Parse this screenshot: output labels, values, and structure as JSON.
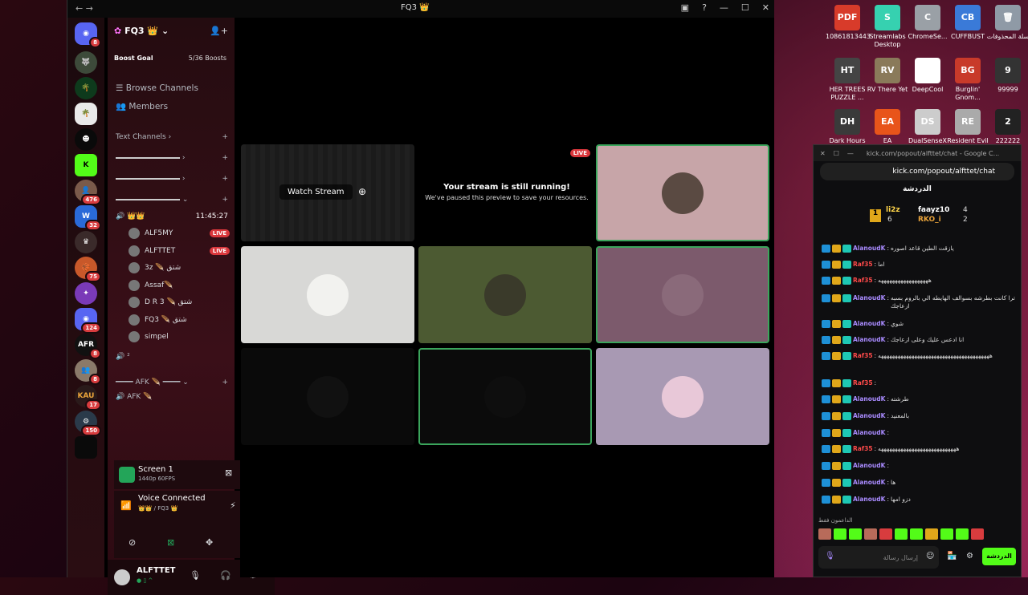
{
  "desktop": {
    "icons": [
      {
        "label": "10861813443",
        "color": "#d83b2a",
        "glyph": "PDF"
      },
      {
        "label": "Streamlabs Desktop",
        "color": "#36d1b0",
        "glyph": "S"
      },
      {
        "label": "ChromeSe...",
        "color": "#9aa0a6",
        "glyph": "C"
      },
      {
        "label": "CUFFBUST",
        "color": "#3a7ad8",
        "glyph": "CB"
      },
      {
        "label": "سلة المحذوفات",
        "color": "#8f9aa6",
        "glyph": "🗑"
      },
      {
        "label": "HER TREES PUZZLE ...",
        "color": "#444",
        "glyph": "HT"
      },
      {
        "label": "RV There Yet",
        "color": "#8a7a5a",
        "glyph": "RV"
      },
      {
        "label": "DeepCool",
        "color": "#ffffff",
        "glyph": "DC"
      },
      {
        "label": "Burglin' Gnom...",
        "color": "#c83a2a",
        "glyph": "BG"
      },
      {
        "label": "99999",
        "color": "#333",
        "glyph": "9"
      },
      {
        "label": "Dark Hours",
        "color": "#3a3a3a",
        "glyph": "DH"
      },
      {
        "label": "EA",
        "color": "#e8541a",
        "glyph": "EA"
      },
      {
        "label": "DualSenseX",
        "color": "#cccccc",
        "glyph": "DS"
      },
      {
        "label": "Resident Evil",
        "color": "#aaaaaa",
        "glyph": "RE"
      },
      {
        "label": "222222",
        "color": "#222",
        "glyph": "2"
      }
    ]
  },
  "discord": {
    "window_title": "FQ3 👑",
    "server_name": "FQ3 👑",
    "boost_goal": "Boost Goal",
    "boost_count": "5/36 Boosts",
    "browse_channels": "Browse Channels",
    "members": "Members",
    "text_channels": "Text Channels",
    "voice_channel_time": "11:45:27",
    "server_badges": [
      "8",
      "476",
      "32",
      "75",
      "124",
      "8",
      "8",
      "17",
      "150"
    ],
    "voice_users": [
      {
        "name": "ALF5MY",
        "live": "LIVE"
      },
      {
        "name": "ALFTTET",
        "live": "LIVE"
      },
      {
        "name": "3z 🪶 شتق",
        "live": ""
      },
      {
        "name": "Assaf🪶",
        "live": ""
      },
      {
        "name": "D R 3 🪶 شتق",
        "live": ""
      },
      {
        "name": "FQ3 🪶 شتق",
        "live": ""
      },
      {
        "name": "simpel",
        "live": ""
      }
    ],
    "voice_channel_2": "²",
    "afk_category": "AFK",
    "afk_channel": "AFK 🪶",
    "screen_title": "Screen 1",
    "screen_quality": "1440p 60FPS",
    "voice_connected": "Voice Connected",
    "voice_path": "👑👑 / FQ3 👑",
    "username": "ALFTTET",
    "user_status": "● ▯ ^"
  },
  "stage": {
    "watch_stream": "Watch Stream",
    "paused_title": "Your stream is still running!",
    "paused_sub": "We've paused this preview to save your resources.",
    "live_badge": "LIVE"
  },
  "kick_chat": {
    "tab_title": "kick.com/popout/alfttet/chat - Google C...",
    "url": "kick.com/popout/alfttet/chat",
    "header": "الدردشة",
    "leaders": [
      {
        "rank": "1",
        "name": "li2z",
        "count": "6"
      },
      {
        "name": "faayz10",
        "count": "4"
      },
      {
        "name": "RKO_i",
        "count": "2"
      }
    ],
    "messages": [
      {
        "user": "AlanoudK",
        "cls": "u-a",
        "text": "يازقت الطين قاعد اصوره"
      },
      {
        "user": "Raf35",
        "cls": "u-r",
        "text": "اما"
      },
      {
        "user": "Raf35",
        "cls": "u-r",
        "text": "ههههههههههههههههههه"
      },
      {
        "user": "AlanoudK",
        "cls": "u-a",
        "text": "ترا كانت بطرشه بسوالف الهايطه الي بالروم بسبه ازعاجك"
      },
      {
        "user": "AlanoudK",
        "cls": "u-a",
        "text": "شوي"
      },
      {
        "user": "AlanoudK",
        "cls": "u-a",
        "text": "انا ادعس عليك وعلى ازعاجك"
      },
      {
        "user": "Raf35",
        "cls": "u-r",
        "text": "ههههههههههههههههههههههههههههههههههههههههه"
      },
      {
        "user": "Raf35",
        "cls": "u-r",
        "text": ""
      },
      {
        "user": "AlanoudK",
        "cls": "u-a",
        "text": "طرشته"
      },
      {
        "user": "AlanoudK",
        "cls": "u-a",
        "text": "بالمعنيد"
      },
      {
        "user": "AlanoudK",
        "cls": "u-a",
        "text": ""
      },
      {
        "user": "Raf35",
        "cls": "u-r",
        "text": "ههههههههههههههههههههههههههههه"
      },
      {
        "user": "AlanoudK",
        "cls": "u-a",
        "text": ""
      },
      {
        "user": "AlanoudK",
        "cls": "u-a",
        "text": "ها"
      },
      {
        "user": "AlanoudK",
        "cls": "u-a",
        "text": "دزو امها"
      }
    ],
    "supporters_label": "الداعمون فقط",
    "input_placeholder": "إرسال رسالة",
    "send_button": "الدردشة"
  }
}
